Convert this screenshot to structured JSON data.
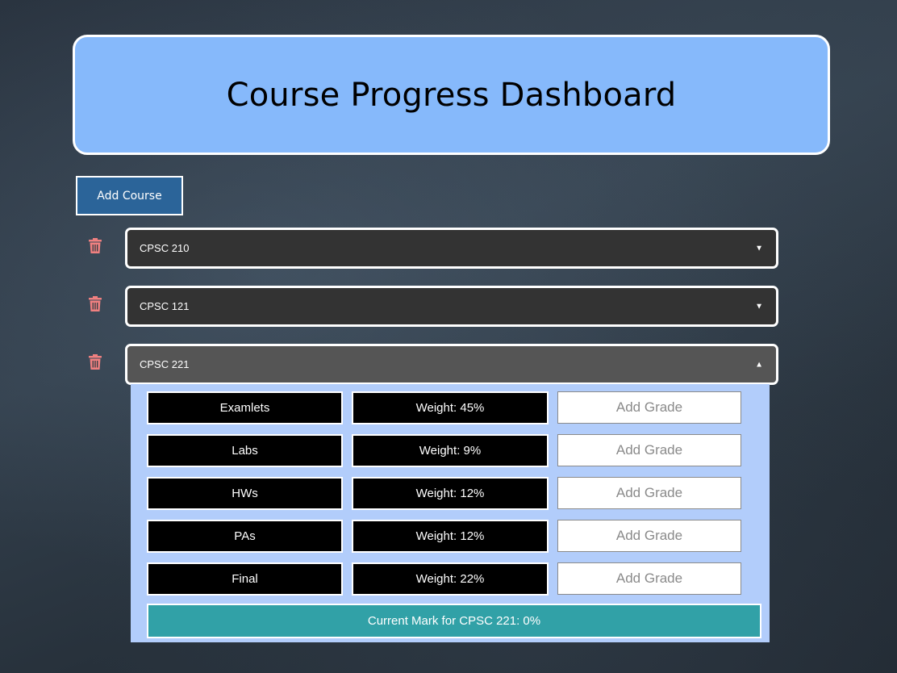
{
  "header": {
    "title": "Course Progress Dashboard"
  },
  "toolbar": {
    "add_course_label": "Add Course"
  },
  "courses": [
    {
      "name": "CPSC 210",
      "expanded": false,
      "toggle_icon": "▼"
    },
    {
      "name": "CPSC 121",
      "expanded": false,
      "toggle_icon": "▼"
    },
    {
      "name": "CPSC 221",
      "expanded": true,
      "toggle_icon": "▲"
    }
  ],
  "expanded_course": {
    "components": [
      {
        "name": "Examlets",
        "weight": "Weight: 45%",
        "grade_placeholder": "Add Grade"
      },
      {
        "name": "Labs",
        "weight": "Weight: 9%",
        "grade_placeholder": "Add Grade"
      },
      {
        "name": "HWs",
        "weight": "Weight: 12%",
        "grade_placeholder": "Add Grade"
      },
      {
        "name": "PAs",
        "weight": "Weight: 12%",
        "grade_placeholder": "Add Grade"
      },
      {
        "name": "Final",
        "weight": "Weight: 22%",
        "grade_placeholder": "Add Grade"
      }
    ],
    "current_mark": "Current Mark for CPSC 221: 0%"
  },
  "colors": {
    "header_bg": "#86b9fb",
    "add_button_bg": "#2b6499",
    "course_bar_bg": "#333333",
    "course_bar_open_bg": "#555555",
    "panel_bg": "#b2cdfb",
    "current_mark_bg": "#31a1a7",
    "trash_icon": "#f08080"
  },
  "icons": {
    "delete": "trash-icon",
    "collapsed": "caret-down-icon",
    "expanded": "caret-up-icon"
  }
}
